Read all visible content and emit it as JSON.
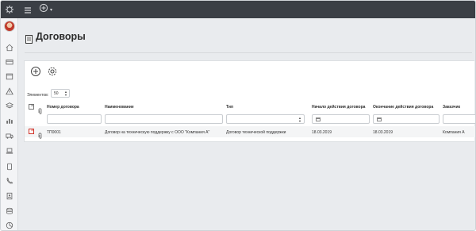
{
  "topbar": {
    "menu_icon": "hamburger-icon",
    "add_icon": "plus-circle-icon",
    "add_caret": "▾"
  },
  "sidebar": {
    "logo_icon": "gear-logo-icon",
    "avatar": "avatar",
    "items": [
      {
        "icon": "home-icon"
      },
      {
        "icon": "card-icon"
      },
      {
        "icon": "calendar-icon"
      },
      {
        "icon": "warning-icon"
      },
      {
        "icon": "layers-icon"
      },
      {
        "icon": "bar-chart-icon"
      },
      {
        "icon": "truck-icon"
      },
      {
        "icon": "laptop-icon"
      },
      {
        "icon": "tablet-icon"
      },
      {
        "icon": "phone-icon"
      },
      {
        "icon": "contacts-icon"
      },
      {
        "icon": "database-icon"
      },
      {
        "icon": "pie-chart-icon"
      }
    ]
  },
  "page": {
    "title": "Договоры",
    "title_icon": "document-icon"
  },
  "toolbar": {
    "add_icon": "plus-circle-icon",
    "settings_icon": "gear-icon"
  },
  "pager": {
    "label": "Элементов:",
    "value": "50"
  },
  "table": {
    "columns": [
      "Номер договора",
      "Наименование",
      "Тип",
      "Начало действия договора",
      "Окончание действия договора",
      "Заказчик"
    ],
    "rows": [
      {
        "number": "ТП0001",
        "name": "Договор на техническую поддержку с ООО \"Компания А\"",
        "type": "Договор технической поддержки",
        "start": "18.03.2019",
        "end": "18.03.2019",
        "customer": "Компания А"
      }
    ]
  },
  "colors": {
    "topbar": "#3b3f45",
    "background": "#e9ebee",
    "delete_red": "#d0352b"
  }
}
